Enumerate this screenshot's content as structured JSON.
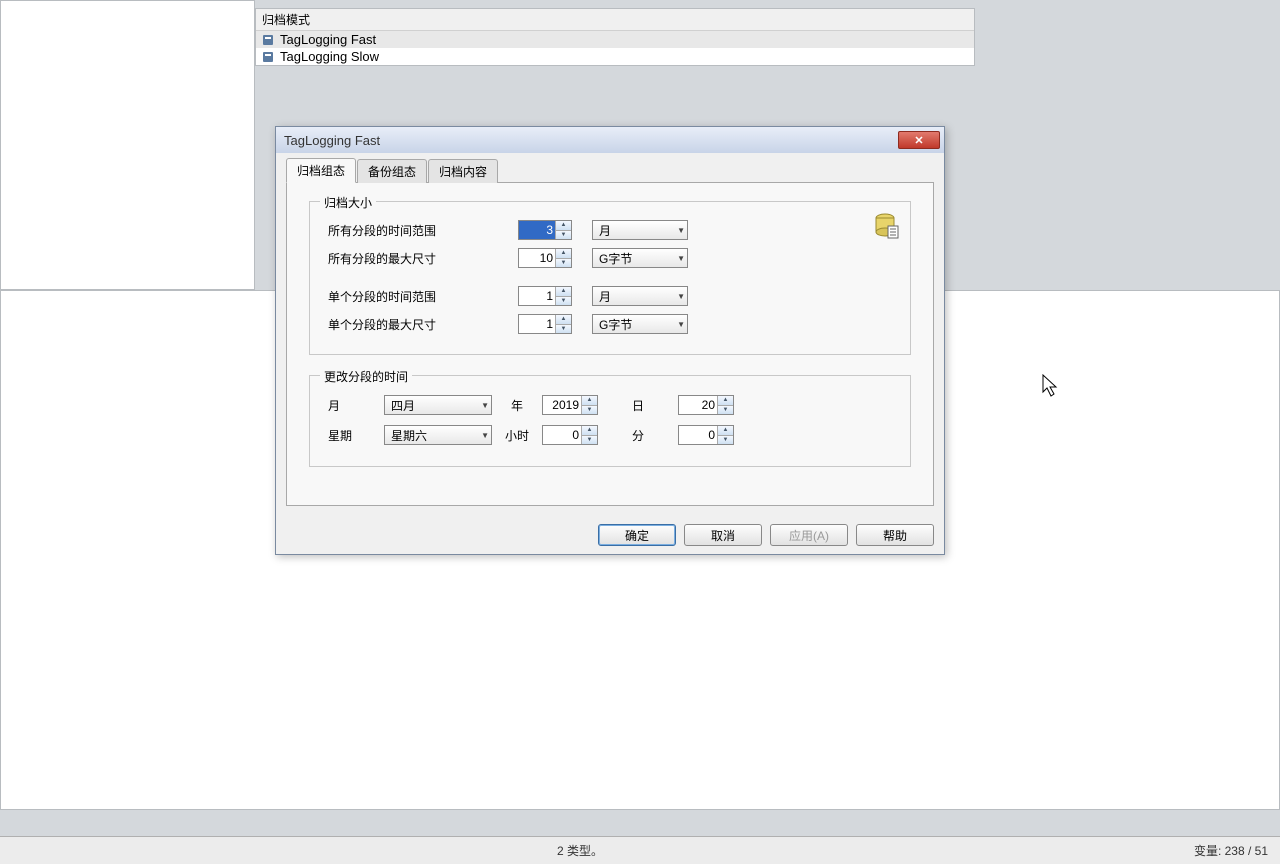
{
  "sidebar": {
    "header": "归档模式",
    "items": [
      {
        "label": "TagLogging Fast",
        "selected": true
      },
      {
        "label": "TagLogging Slow",
        "selected": false
      }
    ]
  },
  "dialog": {
    "title": "TagLogging Fast",
    "tabs": [
      "归档组态",
      "备份组态",
      "归档内容"
    ],
    "active_tab": 0,
    "archive_size": {
      "group_title": "归档大小",
      "rows": {
        "all_range_label": "所有分段的时间范围",
        "all_range_value": "3",
        "all_range_unit": "月",
        "all_max_label": "所有分段的最大尺寸",
        "all_max_value": "10",
        "all_max_unit": "G字节",
        "single_range_label": "单个分段的时间范围",
        "single_range_value": "1",
        "single_range_unit": "月",
        "single_max_label": "单个分段的最大尺寸",
        "single_max_value": "1",
        "single_max_unit": "G字节"
      }
    },
    "change_time": {
      "group_title": "更改分段的时间",
      "month_label": "月",
      "month_value": "四月",
      "year_label": "年",
      "year_value": "2019",
      "day_label": "日",
      "day_value": "20",
      "weekday_label": "星期",
      "weekday_value": "星期六",
      "hour_label": "小时",
      "hour_value": "0",
      "minute_label": "分",
      "minute_value": "0"
    },
    "buttons": {
      "ok": "确定",
      "cancel": "取消",
      "apply": "应用(A)",
      "help": "帮助"
    }
  },
  "statusbar": {
    "mid": "2 类型。",
    "right": "变量: 238 / 51"
  }
}
